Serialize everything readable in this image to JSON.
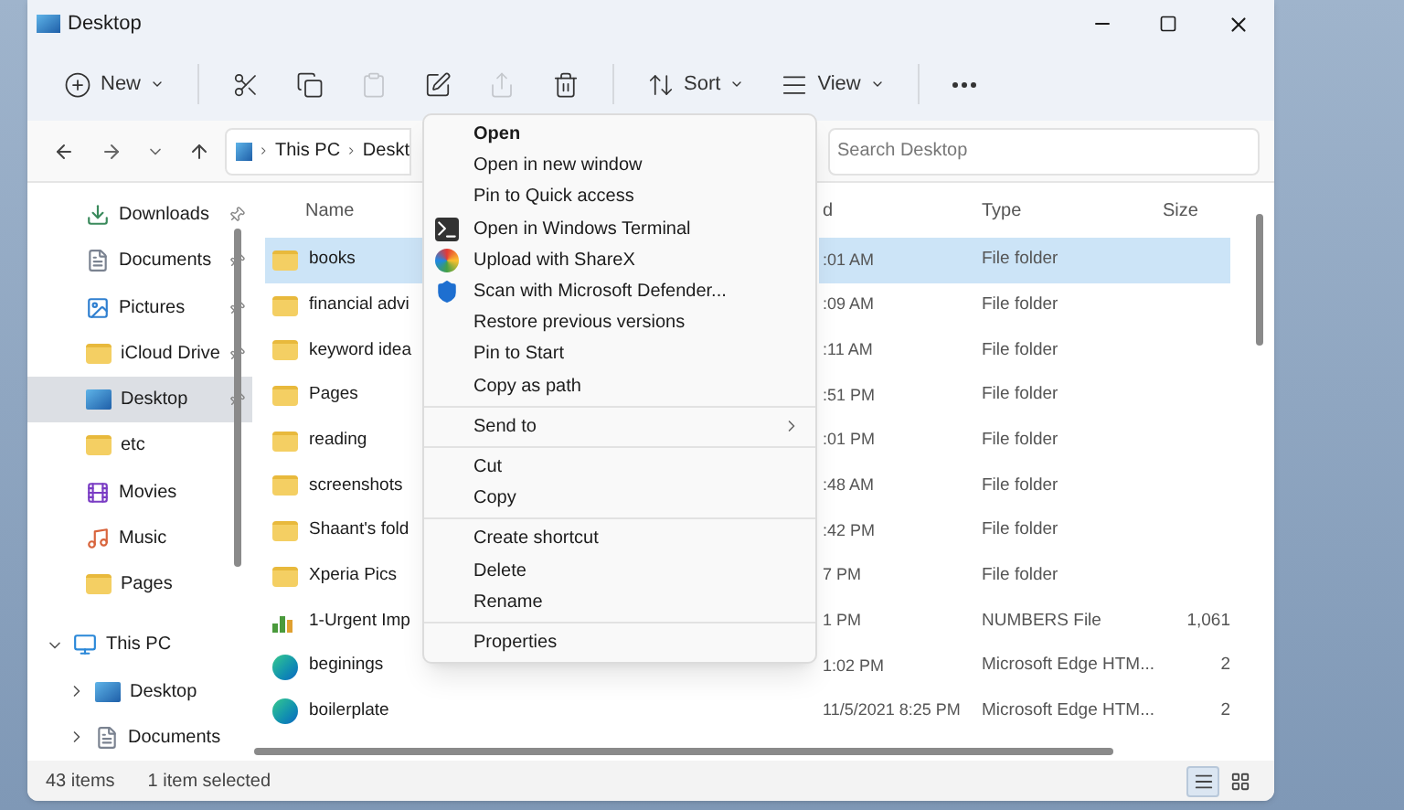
{
  "window": {
    "title": "Desktop"
  },
  "toolbar": [
    {
      "kind": "new",
      "label": "New",
      "disabled": false
    },
    {
      "kind": "cut",
      "disabled": false
    },
    {
      "kind": "copy",
      "disabled": false
    },
    {
      "kind": "paste",
      "disabled": true
    },
    {
      "kind": "rename",
      "disabled": false
    },
    {
      "kind": "share",
      "disabled": true
    },
    {
      "kind": "delete",
      "disabled": false
    },
    {
      "kind": "sort",
      "label": "Sort",
      "disabled": false
    },
    {
      "kind": "view",
      "label": "View",
      "disabled": false
    },
    {
      "kind": "more",
      "disabled": false
    }
  ],
  "address": {
    "crumbs": [
      "This PC",
      "Deskt"
    ],
    "search_placeholder": "Search Desktop"
  },
  "sidebar": {
    "items": [
      {
        "kind": "downloads",
        "label": "Downloads",
        "pinned": true,
        "selected": false
      },
      {
        "kind": "documents",
        "label": "Documents",
        "pinned": true,
        "selected": false
      },
      {
        "kind": "pictures",
        "label": "Pictures",
        "pinned": true,
        "selected": false
      },
      {
        "kind": "folder",
        "label": "iCloud Drive",
        "pinned": true,
        "selected": false
      },
      {
        "kind": "desktop",
        "label": "Desktop",
        "pinned": true,
        "selected": true
      },
      {
        "kind": "folder",
        "label": "etc",
        "pinned": false,
        "selected": false
      },
      {
        "kind": "movies",
        "label": "Movies",
        "pinned": false,
        "selected": false
      },
      {
        "kind": "music",
        "label": "Music",
        "pinned": false,
        "selected": false
      },
      {
        "kind": "folder",
        "label": "Pages",
        "pinned": false,
        "selected": false
      },
      {
        "kind": "pc",
        "label": "This PC",
        "pinned": false,
        "selected": false,
        "expanded": true,
        "children": [
          {
            "kind": "desktop",
            "label": "Desktop",
            "pinned": false,
            "selected": false,
            "expanded": false
          },
          {
            "kind": "documents",
            "label": "Documents",
            "pinned": false,
            "selected": false,
            "expanded": false
          }
        ]
      }
    ]
  },
  "table": {
    "columns": [
      "Name",
      "d",
      "Type",
      "Size"
    ],
    "rows": [
      {
        "kind": "folder",
        "name": "books",
        "date": ":01 AM",
        "type": "File folder",
        "size": "",
        "selected": true
      },
      {
        "kind": "folder",
        "name": "financial advi",
        "date": ":09 AM",
        "type": "File folder",
        "size": "",
        "selected": false
      },
      {
        "kind": "folder",
        "name": "keyword idea",
        "date": ":11 AM",
        "type": "File folder",
        "size": "",
        "selected": false
      },
      {
        "kind": "folder",
        "name": "Pages",
        "date": ":51 PM",
        "type": "File folder",
        "size": "",
        "selected": false
      },
      {
        "kind": "folder",
        "name": "reading",
        "date": ":01 PM",
        "type": "File folder",
        "size": "",
        "selected": false
      },
      {
        "kind": "folder",
        "name": "screenshots",
        "date": ":48 AM",
        "type": "File folder",
        "size": "",
        "selected": false
      },
      {
        "kind": "folder",
        "name": "Shaant's fold",
        "date": ":42 PM",
        "type": "File folder",
        "size": "",
        "selected": false
      },
      {
        "kind": "folder",
        "name": "Xperia Pics",
        "date": "7 PM",
        "type": "File folder",
        "size": "",
        "selected": false
      },
      {
        "kind": "numbers",
        "name": "1-Urgent Imp",
        "date": "1 PM",
        "type": "NUMBERS File",
        "size": "1,061",
        "selected": false
      },
      {
        "kind": "edge",
        "name": "beginings",
        "date": "1:02 PM",
        "type": "Microsoft Edge HTM...",
        "size": "2",
        "selected": false
      },
      {
        "kind": "edge",
        "name": "boilerplate",
        "date": "11/5/2021 8:25 PM",
        "type": "Microsoft Edge HTM...",
        "size": "2",
        "selected": false
      }
    ]
  },
  "context_menu": [
    {
      "kind": "item",
      "label": "Open",
      "bold": true
    },
    {
      "kind": "item",
      "label": "Open in new window",
      "bold": false
    },
    {
      "kind": "item",
      "label": "Pin to Quick access",
      "bold": false
    },
    {
      "kind": "terminal",
      "label": "Open in Windows Terminal",
      "bold": false
    },
    {
      "kind": "sharex",
      "label": "Upload with ShareX",
      "bold": false
    },
    {
      "kind": "defender",
      "label": "Scan with Microsoft Defender...",
      "bold": false
    },
    {
      "kind": "item",
      "label": "Restore previous versions",
      "bold": false
    },
    {
      "kind": "item",
      "label": "Pin to Start",
      "bold": false
    },
    {
      "kind": "item",
      "label": "Copy as path",
      "bold": false
    },
    {
      "kind": "separator"
    },
    {
      "kind": "submenu",
      "label": "Send to",
      "bold": false
    },
    {
      "kind": "separator"
    },
    {
      "kind": "item",
      "label": "Cut",
      "bold": false
    },
    {
      "kind": "item",
      "label": "Copy",
      "bold": false
    },
    {
      "kind": "separator"
    },
    {
      "kind": "item",
      "label": "Create shortcut",
      "bold": false
    },
    {
      "kind": "item",
      "label": "Delete",
      "bold": false
    },
    {
      "kind": "item",
      "label": "Rename",
      "bold": false
    },
    {
      "kind": "separator"
    },
    {
      "kind": "item",
      "label": "Properties",
      "bold": false
    }
  ],
  "status_bar": {
    "count": "43 items",
    "selection": "1 item selected",
    "views": [
      {
        "kind": "details",
        "selected": true
      },
      {
        "kind": "tiles",
        "selected": false
      }
    ]
  }
}
